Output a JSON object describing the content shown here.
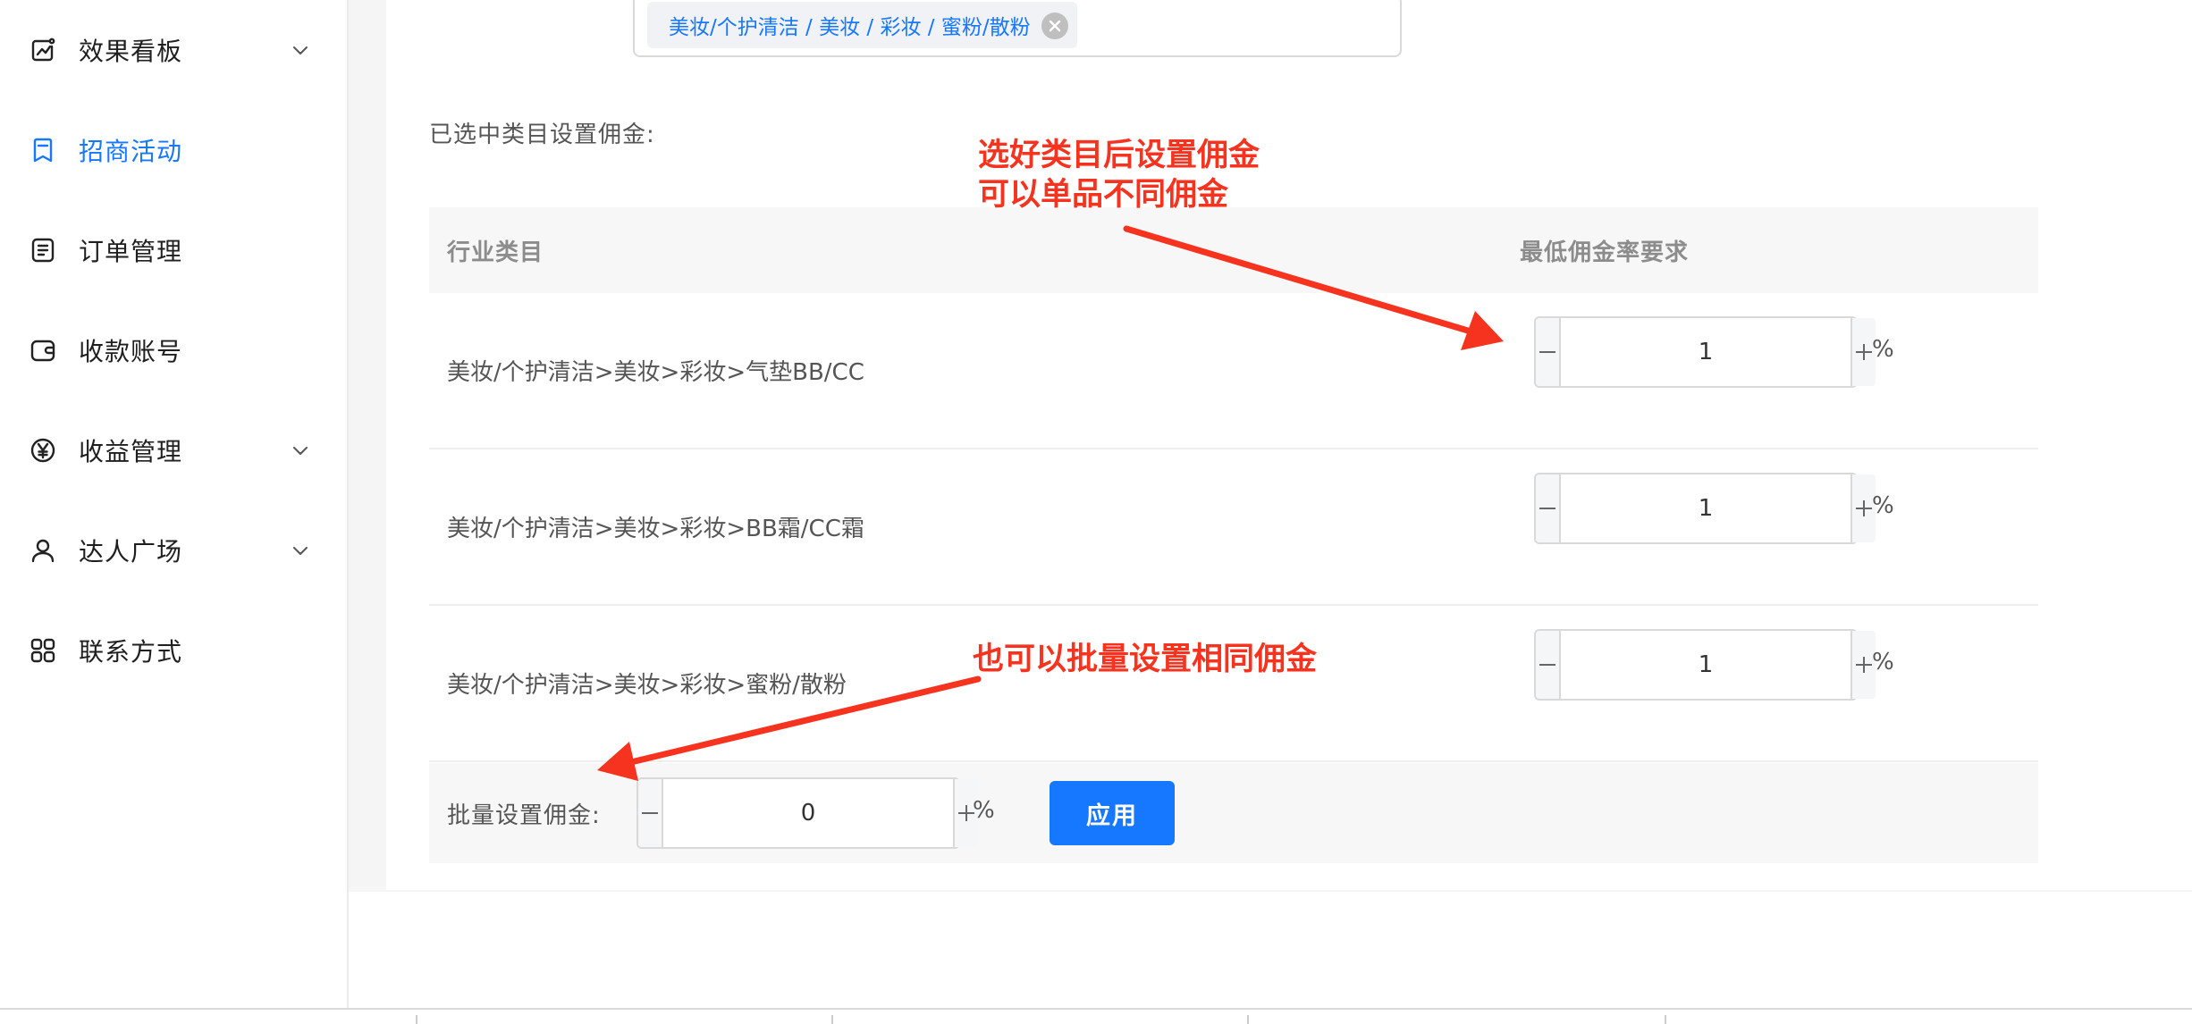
{
  "sidebar": {
    "items": [
      {
        "label": "效果看板",
        "icon": "chart-board-icon",
        "has_chevron": true,
        "active": false
      },
      {
        "label": "招商活动",
        "icon": "bookmark-icon",
        "has_chevron": false,
        "active": true
      },
      {
        "label": "订单管理",
        "icon": "order-list-icon",
        "has_chevron": false,
        "active": false
      },
      {
        "label": "收款账号",
        "icon": "wallet-icon",
        "has_chevron": false,
        "active": false
      },
      {
        "label": "收益管理",
        "icon": "yen-circle-icon",
        "has_chevron": true,
        "active": false
      },
      {
        "label": "达人广场",
        "icon": "user-icon",
        "has_chevron": true,
        "active": false
      },
      {
        "label": "联系方式",
        "icon": "grid-apps-icon",
        "has_chevron": false,
        "active": false
      }
    ]
  },
  "category_select": {
    "tag": "美妆/个护清洁 / 美妆 / 彩妆 / 蜜粉/散粉"
  },
  "commission": {
    "section_label": "已选中类目设置佣金:",
    "header": {
      "category": "行业类目",
      "min_rate": "最低佣金率要求"
    },
    "rows": [
      {
        "category": "美妆/个护清洁>美妆>彩妆>气垫BB/CC",
        "value": "1",
        "unit": "%"
      },
      {
        "category": "美妆/个护清洁>美妆>彩妆>BB霜/CC霜",
        "value": "1",
        "unit": "%"
      },
      {
        "category": "美妆/个护清洁>美妆>彩妆>蜜粉/散粉",
        "value": "1",
        "unit": "%"
      }
    ],
    "batch": {
      "label": "批量设置佣金:",
      "value": "0",
      "unit": "%",
      "apply_label": "应用"
    }
  },
  "annotations": {
    "top_line1": "选好类目后设置佣金",
    "top_line2": "可以单品不同佣金",
    "bottom": "也可以批量设置相同佣金"
  },
  "colors": {
    "accent": "#1677ff",
    "annotation": "#f5331f"
  }
}
